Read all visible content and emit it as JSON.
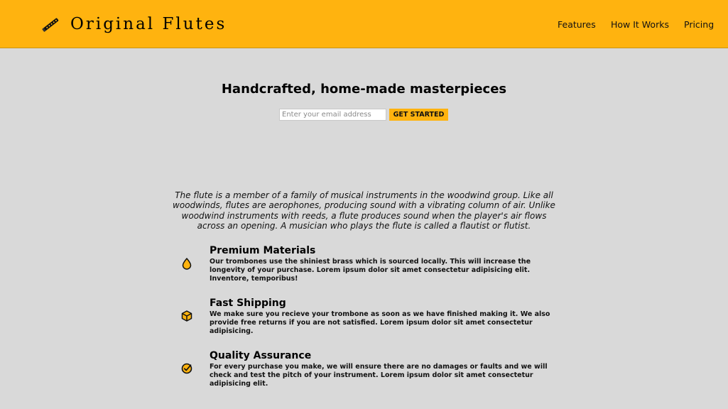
{
  "header": {
    "brand": "Original Flutes",
    "logo_icon": "flute-icon",
    "nav": [
      {
        "label": "Features"
      },
      {
        "label": "How It Works"
      },
      {
        "label": "Pricing"
      }
    ]
  },
  "hero": {
    "title": "Handcrafted, home-made masterpieces",
    "email_placeholder": "Enter your email address",
    "button_label": "GET STARTED"
  },
  "description": "The flute is a member of a family of musical instruments in the woodwind group. Like all woodwinds, flutes are aerophones, producing sound with a vibrating column of air. Unlike woodwind instruments with reeds, a flute produces sound when the player's air flows across an opening. A musician who plays the flute is called a flautist or flutist.",
  "features": [
    {
      "icon": "drop-icon",
      "title": "Premium Materials",
      "text": "Our trombones use the shiniest brass which is sourced locally. This will increase the longevity of your purchase. Lorem ipsum dolor sit amet consectetur adipisicing elit. Inventore, temporibus!"
    },
    {
      "icon": "box-icon",
      "title": "Fast Shipping",
      "text": "We make sure you recieve your trombone as soon as we have finished making it. We also provide free returns if you are not satisfied. Lorem ipsum dolor sit amet consectetur adipisicing."
    },
    {
      "icon": "check-circle-icon",
      "title": "Quality Assurance",
      "text": "For every purchase you make, we will ensure there are no damages or faults and we will check and test the pitch of your instrument. Lorem ipsum dolor sit amet consectetur adipisicing elit."
    }
  ],
  "colors": {
    "accent": "#ffb30f",
    "background": "#d9d9d9"
  }
}
